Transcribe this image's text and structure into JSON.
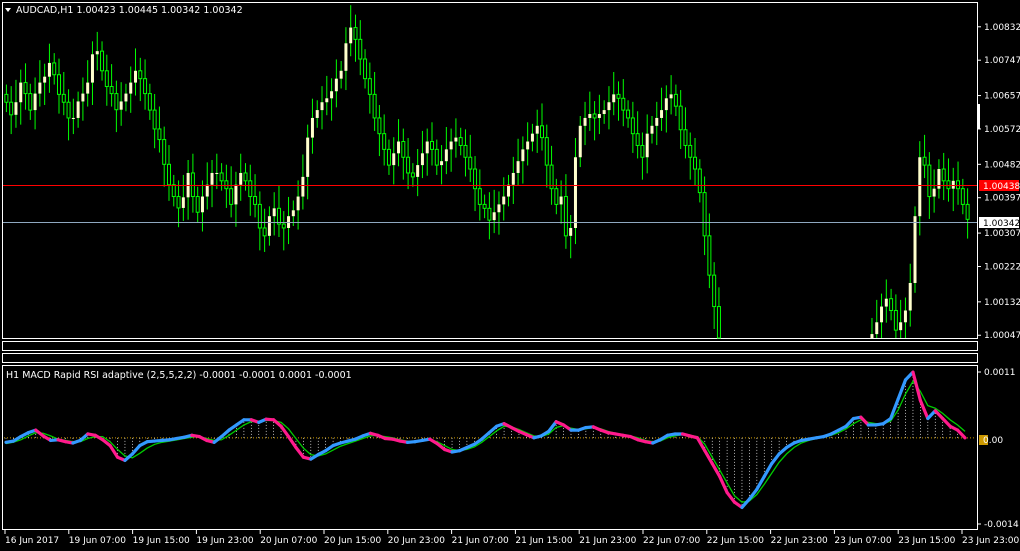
{
  "symbol_header": "AUDCAD,H1  1.00423 1.00445 1.00342 1.00342",
  "price_axis": {
    "ticks": [
      "1.00832",
      "1.00747",
      "1.00657",
      "1.00572",
      "1.00482",
      "1.00397",
      "1.00307",
      "1.00222",
      "1.00132",
      "1.00047"
    ],
    "ask_label": "1.00438",
    "bid_label": "1.00342"
  },
  "indicator": {
    "header": "H1 MACD Rapid RSI adaptive (2,5,5,2,2) -0.0001 -0.0001 0.0001 -0.0001",
    "ticks": [
      "0.0011",
      "0.00",
      "-0.0014"
    ],
    "zero_label": "0.00"
  },
  "time_axis": [
    "16 Jun 2017",
    "19 Jun 07:00",
    "19 Jun 15:00",
    "19 Jun 23:00",
    "20 Jun 07:00",
    "20 Jun 15:00",
    "20 Jun 23:00",
    "21 Jun 07:00",
    "21 Jun 15:00",
    "21 Jun 23:00",
    "22 Jun 07:00",
    "22 Jun 15:00",
    "22 Jun 23:00",
    "23 Jun 07:00",
    "23 Jun 15:00",
    "23 Jun 23:00"
  ],
  "colors": {
    "background": "#000000",
    "frame": "#ffffff",
    "bull_candle": "#ffffcc",
    "wick": "#00ff00",
    "ask_line": "#ff0000",
    "bid_line": "#8fa8c0",
    "macd_up": "#3399ff",
    "macd_down": "#ff1a8c",
    "signal": "#00cc00",
    "histogram": "#ffffff",
    "zero_line": "#cc9900"
  },
  "chart_data": {
    "type": "candlestick",
    "symbol": "AUDCAD",
    "timeframe": "H1",
    "ylim": [
      1.0004,
      1.0089
    ],
    "current": {
      "open": 1.00423,
      "high": 1.00445,
      "low": 1.00342,
      "close": 1.00342
    },
    "close": [
      1.0064,
      1.00608,
      1.0064,
      1.0069,
      1.00662,
      1.0062,
      1.00662,
      1.0069,
      1.00705,
      1.0074,
      1.0071,
      1.0066,
      1.0064,
      1.006,
      1.006,
      1.00642,
      1.00662,
      1.0069,
      1.00762,
      1.0077,
      1.0072,
      1.0068,
      1.00662,
      1.00621,
      1.00642,
      1.00662,
      1.0069,
      1.0072,
      1.007,
      1.00662,
      1.0062,
      1.00572,
      1.00545,
      1.00482,
      1.0043,
      1.004,
      1.00371,
      1.00398,
      1.0046,
      1.004,
      1.0036,
      1.004,
      1.0043,
      1.0046,
      1.0046,
      1.0044,
      1.0042,
      1.0038,
      1.0043,
      1.0046,
      1.0044,
      1.004,
      1.0038,
      1.0032,
      1.003,
      1.0035,
      1.0037,
      1.0033,
      1.0032,
      1.0035,
      1.00365,
      1.004,
      1.0045,
      1.0055,
      1.006,
      1.0062,
      1.0064,
      1.0065,
      1.00668,
      1.007,
      1.0072,
      1.0079,
      1.0083,
      1.008,
      1.0075,
      1.007,
      1.0066,
      1.006,
      1.0056,
      1.0052,
      1.0048,
      1.0051,
      1.0054,
      1.005,
      1.0046,
      1.0045,
      1.0048,
      1.0051,
      1.0054,
      1.0052,
      1.0048,
      1.0049,
      1.0052,
      1.0054,
      1.0055,
      1.0053,
      1.005,
      1.0047,
      1.0042,
      1.0038,
      1.0037,
      1.0034,
      1.0036,
      1.0038,
      1.004,
      1.0043,
      1.0046,
      1.0049,
      1.0052,
      1.0054,
      1.0056,
      1.0058,
      1.0055,
      1.0048,
      1.0042,
      1.0038,
      1.004,
      1.003,
      1.0032,
      1.005,
      1.0058,
      1.006,
      1.0061,
      1.006,
      1.0061,
      1.0062,
      1.0064,
      1.0066,
      1.0065,
      1.0062,
      1.006,
      1.0056,
      1.0053,
      1.005,
      1.0056,
      1.0058,
      1.006,
      1.0062,
      1.0065,
      1.0066,
      1.0063,
      1.0057,
      1.0053,
      1.005,
      1.0047,
      1.0041,
      1.003,
      1.002,
      1.0012,
      1.0004,
      1.0004,
      1.0004,
      1.0004,
      1.0004,
      1.0004,
      1.0004,
      1.0004,
      1.0004,
      1.0004,
      1.0004,
      1.0004,
      1.0004,
      1.0004,
      1.0004,
      1.0004,
      1.0004,
      1.0004,
      1.0004,
      1.0004,
      1.0004,
      1.0004,
      1.0004,
      1.0004,
      1.0004,
      1.0004,
      1.0004,
      1.0004,
      1.0004,
      1.0004,
      1.0004,
      1.0004,
      1.0005,
      1.0008,
      1.0012,
      1.0014,
      1.0011,
      1.0006,
      1.0008,
      1.0011,
      1.0018,
      1.0035,
      1.005,
      1.0048,
      1.004,
      1.0042,
      1.0047,
      1.0044,
      1.0042,
      1.0044,
      1.0042,
      1.0038,
      1.00342
    ],
    "macd_ylim": [
      -0.0014,
      0.0011
    ],
    "macd": [
      -7e-05,
      -5e-05,
      2e-05,
      8e-05,
      0.00012,
      3e-05,
      -4e-05,
      -3e-05,
      -6e-05,
      -8e-05,
      -4e-05,
      6e-05,
      4e-05,
      -3e-05,
      -0.00012,
      -0.0003,
      -0.00035,
      -0.00025,
      -0.00012,
      -6e-05,
      -5e-05,
      -4e-05,
      -3e-05,
      -1e-05,
      1e-05,
      4e-05,
      2e-05,
      -4e-05,
      -7e-05,
      2e-05,
      0.00012,
      0.0002,
      0.00028,
      0.00028,
      0.00024,
      0.00029,
      0.00028,
      0.00018,
      2e-05,
      -0.00015,
      -0.0003,
      -0.00033,
      -0.00026,
      -0.0002,
      -0.00012,
      -8e-05,
      -5e-05,
      -2e-05,
      3e-05,
      7e-05,
      4e-05,
      -1e-05,
      -2e-05,
      -5e-05,
      -7e-05,
      -6e-05,
      -4e-05,
      -2e-05,
      -9e-05,
      -0.00018,
      -0.00022,
      -0.0002,
      -0.00015,
      -0.0001,
      -2e-05,
      8e-05,
      0.00018,
      0.00022,
      0.00016,
      0.0001,
      5e-05,
      0.0,
      3e-05,
      0.0001,
      0.00025,
      0.0002,
      0.00012,
      0.00012,
      0.00016,
      0.00017,
      0.00012,
      8e-05,
      6e-05,
      4e-05,
      2e-05,
      -3e-05,
      -6e-05,
      -8e-05,
      -3e-05,
      4e-05,
      6e-05,
      6e-05,
      3e-05,
      0.0,
      -0.0002,
      -0.0004,
      -0.0006,
      -0.00085,
      -0.001,
      -0.00108,
      -0.00095,
      -0.0008,
      -0.0006,
      -0.0004,
      -0.00025,
      -0.00015,
      -8e-05,
      -4e-05,
      -2e-05,
      0.0,
      2e-05,
      6e-05,
      0.00012,
      0.00018,
      0.0003,
      0.00032,
      0.0002,
      0.0002,
      0.00022,
      0.0003,
      0.0006,
      0.0009,
      0.00102,
      0.00058,
      0.0003,
      0.00042,
      0.0003,
      0.00018,
      0.00012,
      0.0
    ],
    "signal": [
      -9e-05,
      -7e-05,
      -3e-05,
      3e-05,
      8e-05,
      7e-05,
      3e-05,
      -2e-05,
      -4e-05,
      -6e-05,
      -6e-05,
      -1e-05,
      2e-05,
      2e-05,
      -6e-05,
      -0.00018,
      -0.00028,
      -0.00031,
      -0.00024,
      -0.00016,
      -0.0001,
      -7e-05,
      -5e-05,
      -3e-05,
      -1e-05,
      1e-05,
      2e-05,
      -1e-05,
      -4e-05,
      -3e-05,
      4e-05,
      0.00012,
      0.0002,
      0.00025,
      0.00026,
      0.00027,
      0.00027,
      0.00024,
      0.00014,
      -1e-05,
      -0.00016,
      -0.00026,
      -0.00028,
      -0.00025,
      -0.00019,
      -0.00013,
      -9e-05,
      -5e-05,
      -1e-05,
      3e-05,
      4e-05,
      2e-05,
      0.0,
      -3e-05,
      -5e-05,
      -6e-05,
      -5e-05,
      -3e-05,
      -6e-05,
      -0.00012,
      -0.00018,
      -0.0002,
      -0.00018,
      -0.00014,
      -7e-05,
      2e-05,
      0.00011,
      0.00018,
      0.00017,
      0.00013,
      8e-05,
      3e-05,
      2e-05,
      6e-05,
      0.00016,
      0.00019,
      0.00015,
      0.00013,
      0.00014,
      0.00016,
      0.00014,
      0.0001,
      7e-05,
      5e-05,
      3e-05,
      0.0,
      -4e-05,
      -6e-05,
      -5e-05,
      0.0,
      3e-05,
      5e-05,
      4e-05,
      2e-05,
      -0.0001,
      -0.0003,
      -0.0005,
      -0.0007,
      -0.0009,
      -0.001,
      -0.00098,
      -0.00088,
      -0.00072,
      -0.00055,
      -0.00038,
      -0.00025,
      -0.00015,
      -8e-05,
      -4e-05,
      -1e-05,
      1e-05,
      4e-05,
      8e-05,
      0.00014,
      0.00022,
      0.00028,
      0.00024,
      0.00022,
      0.00022,
      0.00026,
      0.00043,
      0.00068,
      0.00088,
      0.00072,
      0.0005,
      0.00046,
      0.00038,
      0.00028,
      0.0002,
      0.0001
    ]
  }
}
